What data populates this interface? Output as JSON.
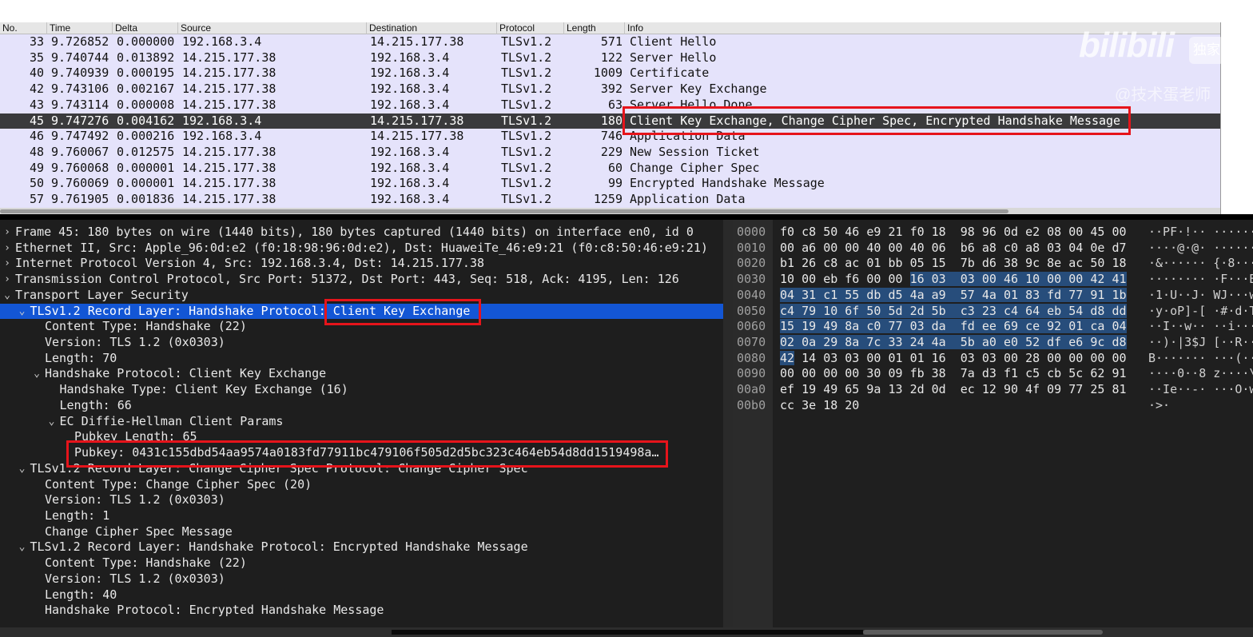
{
  "columns": [
    "No.",
    "Time",
    "Delta",
    "Source",
    "Destination",
    "Protocol",
    "Length",
    "Info"
  ],
  "packets": [
    {
      "no": "33",
      "time": "9.726852",
      "delta": "0.000000",
      "src": "192.168.3.4",
      "dst": "14.215.177.38",
      "proto": "TLSv1.2",
      "len": "571",
      "info": "Client Hello",
      "selected": false
    },
    {
      "no": "35",
      "time": "9.740744",
      "delta": "0.013892",
      "src": "14.215.177.38",
      "dst": "192.168.3.4",
      "proto": "TLSv1.2",
      "len": "122",
      "info": "Server Hello",
      "selected": false
    },
    {
      "no": "40",
      "time": "9.740939",
      "delta": "0.000195",
      "src": "14.215.177.38",
      "dst": "192.168.3.4",
      "proto": "TLSv1.2",
      "len": "1009",
      "info": "Certificate",
      "selected": false
    },
    {
      "no": "42",
      "time": "9.743106",
      "delta": "0.002167",
      "src": "14.215.177.38",
      "dst": "192.168.3.4",
      "proto": "TLSv1.2",
      "len": "392",
      "info": "Server Key Exchange",
      "selected": false
    },
    {
      "no": "43",
      "time": "9.743114",
      "delta": "0.000008",
      "src": "14.215.177.38",
      "dst": "192.168.3.4",
      "proto": "TLSv1.2",
      "len": "63",
      "info": "Server Hello Done",
      "selected": false
    },
    {
      "no": "45",
      "time": "9.747276",
      "delta": "0.004162",
      "src": "192.168.3.4",
      "dst": "14.215.177.38",
      "proto": "TLSv1.2",
      "len": "180",
      "info": "Client Key Exchange, Change Cipher Spec, Encrypted Handshake Message",
      "selected": true
    },
    {
      "no": "46",
      "time": "9.747492",
      "delta": "0.000216",
      "src": "192.168.3.4",
      "dst": "14.215.177.38",
      "proto": "TLSv1.2",
      "len": "746",
      "info": "Application Data",
      "selected": false
    },
    {
      "no": "48",
      "time": "9.760067",
      "delta": "0.012575",
      "src": "14.215.177.38",
      "dst": "192.168.3.4",
      "proto": "TLSv1.2",
      "len": "229",
      "info": "New Session Ticket",
      "selected": false
    },
    {
      "no": "49",
      "time": "9.760068",
      "delta": "0.000001",
      "src": "14.215.177.38",
      "dst": "192.168.3.4",
      "proto": "TLSv1.2",
      "len": "60",
      "info": "Change Cipher Spec",
      "selected": false
    },
    {
      "no": "50",
      "time": "9.760069",
      "delta": "0.000001",
      "src": "14.215.177.38",
      "dst": "192.168.3.4",
      "proto": "TLSv1.2",
      "len": "99",
      "info": "Encrypted Handshake Message",
      "selected": false
    },
    {
      "no": "57",
      "time": "9.761905",
      "delta": "0.001836",
      "src": "14.215.177.38",
      "dst": "192.168.3.4",
      "proto": "TLSv1.2",
      "len": "1259",
      "info": "Application Data",
      "selected": false
    }
  ],
  "details": [
    {
      "text": "Frame 45: 180 bytes on wire (1440 bits), 180 bytes captured (1440 bits) on interface en0, id 0",
      "level": 0,
      "arrow": "›"
    },
    {
      "text": "Ethernet II, Src: Apple_96:0d:e2 (f0:18:98:96:0d:e2), Dst: HuaweiTe_46:e9:21 (f0:c8:50:46:e9:21)",
      "level": 0,
      "arrow": "›"
    },
    {
      "text": "Internet Protocol Version 4, Src: 192.168.3.4, Dst: 14.215.177.38",
      "level": 0,
      "arrow": "›"
    },
    {
      "text": "Transmission Control Protocol, Src Port: 51372, Dst Port: 443, Seq: 518, Ack: 4195, Len: 126",
      "level": 0,
      "arrow": "›"
    },
    {
      "text": "Transport Layer Security",
      "level": 0,
      "arrow": "⌄"
    },
    {
      "text": "TLSv1.2 Record Layer: Handshake Protocol: Client Key Exchange",
      "level": 1,
      "arrow": "⌄",
      "selected": true
    },
    {
      "text": "Content Type: Handshake (22)",
      "level": 2,
      "arrow": ""
    },
    {
      "text": "Version: TLS 1.2 (0x0303)",
      "level": 2,
      "arrow": ""
    },
    {
      "text": "Length: 70",
      "level": 2,
      "arrow": ""
    },
    {
      "text": "Handshake Protocol: Client Key Exchange",
      "level": 2,
      "arrow": "⌄"
    },
    {
      "text": "Handshake Type: Client Key Exchange (16)",
      "level": 3,
      "arrow": ""
    },
    {
      "text": "Length: 66",
      "level": 3,
      "arrow": ""
    },
    {
      "text": "EC Diffie-Hellman Client Params",
      "level": 3,
      "arrow": "⌄"
    },
    {
      "text": "Pubkey Length: 65",
      "level": 4,
      "arrow": ""
    },
    {
      "text": "Pubkey: 0431c155dbd54aa9574a0183fd77911bc479106f505d2d5bc323c464eb54d8dd1519498a…",
      "level": 4,
      "arrow": ""
    },
    {
      "text": "TLSv1.2 Record Layer: Change Cipher Spec Protocol: Change Cipher Spec",
      "level": 1,
      "arrow": "⌄"
    },
    {
      "text": "Content Type: Change Cipher Spec (20)",
      "level": 2,
      "arrow": ""
    },
    {
      "text": "Version: TLS 1.2 (0x0303)",
      "level": 2,
      "arrow": ""
    },
    {
      "text": "Length: 1",
      "level": 2,
      "arrow": ""
    },
    {
      "text": "Change Cipher Spec Message",
      "level": 2,
      "arrow": ""
    },
    {
      "text": "TLSv1.2 Record Layer: Handshake Protocol: Encrypted Handshake Message",
      "level": 1,
      "arrow": "⌄"
    },
    {
      "text": "Content Type: Handshake (22)",
      "level": 2,
      "arrow": ""
    },
    {
      "text": "Version: TLS 1.2 (0x0303)",
      "level": 2,
      "arrow": ""
    },
    {
      "text": "Length: 40",
      "level": 2,
      "arrow": ""
    },
    {
      "text": "Handshake Protocol: Encrypted Handshake Message",
      "level": 2,
      "arrow": ""
    }
  ],
  "hexdump": [
    {
      "offset": "0000",
      "bytes": [
        "f0",
        "c8",
        "50",
        "46",
        "e9",
        "21",
        "f0",
        "18",
        "98",
        "96",
        "0d",
        "e2",
        "08",
        "00",
        "45",
        "00"
      ],
      "ascii": "··PF·!·· ······E·",
      "hl_start": -1
    },
    {
      "offset": "0010",
      "bytes": [
        "00",
        "a6",
        "00",
        "00",
        "40",
        "00",
        "40",
        "06",
        "b6",
        "a8",
        "c0",
        "a8",
        "03",
        "04",
        "0e",
        "d7"
      ],
      "ascii": "····@·@· ········",
      "hl_start": -1
    },
    {
      "offset": "0020",
      "bytes": [
        "b1",
        "26",
        "c8",
        "ac",
        "01",
        "bb",
        "05",
        "15",
        "7b",
        "d6",
        "38",
        "9c",
        "8e",
        "ac",
        "50",
        "18"
      ],
      "ascii": "·&······ {·8···P·",
      "hl_start": -1
    },
    {
      "offset": "0030",
      "bytes": [
        "10",
        "00",
        "eb",
        "f6",
        "00",
        "00",
        "16",
        "03",
        "03",
        "00",
        "46",
        "10",
        "00",
        "00",
        "42",
        "41"
      ],
      "ascii": "········ ·F···BA",
      "hl_start": 6
    },
    {
      "offset": "0040",
      "bytes": [
        "04",
        "31",
        "c1",
        "55",
        "db",
        "d5",
        "4a",
        "a9",
        "57",
        "4a",
        "01",
        "83",
        "fd",
        "77",
        "91",
        "1b"
      ],
      "ascii": "·1·U··J· WJ···w··",
      "hl_start": 0
    },
    {
      "offset": "0050",
      "bytes": [
        "c4",
        "79",
        "10",
        "6f",
        "50",
        "5d",
        "2d",
        "5b",
        "c3",
        "23",
        "c4",
        "64",
        "eb",
        "54",
        "d8",
        "dd"
      ],
      "ascii": "·y·oP]-[ ·#·d·T··",
      "hl_start": 0
    },
    {
      "offset": "0060",
      "bytes": [
        "15",
        "19",
        "49",
        "8a",
        "c0",
        "77",
        "03",
        "da",
        "fd",
        "ee",
        "69",
        "ce",
        "92",
        "01",
        "ca",
        "04"
      ],
      "ascii": "··I··w·· ··i·····",
      "hl_start": 0
    },
    {
      "offset": "0070",
      "bytes": [
        "02",
        "0a",
        "29",
        "8a",
        "7c",
        "33",
        "24",
        "4a",
        "5b",
        "a0",
        "e0",
        "52",
        "df",
        "e6",
        "9c",
        "d8"
      ],
      "ascii": "··)·|3$J [··R····",
      "hl_start": 0
    },
    {
      "offset": "0080",
      "bytes": [
        "42",
        "14",
        "03",
        "03",
        "00",
        "01",
        "01",
        "16",
        "03",
        "03",
        "00",
        "28",
        "00",
        "00",
        "00",
        "00"
      ],
      "ascii": "B······· ···(····",
      "hl_start": 0,
      "hl_end": 1
    },
    {
      "offset": "0090",
      "bytes": [
        "00",
        "00",
        "00",
        "00",
        "30",
        "09",
        "fb",
        "38",
        "7a",
        "d3",
        "f1",
        "c5",
        "cb",
        "5c",
        "62",
        "91"
      ],
      "ascii": "····0··8 z····\\b·",
      "hl_start": -1
    },
    {
      "offset": "00a0",
      "bytes": [
        "ef",
        "19",
        "49",
        "65",
        "9a",
        "13",
        "2d",
        "0d",
        "ec",
        "12",
        "90",
        "4f",
        "09",
        "77",
        "25",
        "81"
      ],
      "ascii": "··Ie··-· ···O·w%·",
      "hl_start": -1
    },
    {
      "offset": "00b0",
      "bytes": [
        "cc",
        "3e",
        "18",
        "20"
      ],
      "ascii": "·>· ",
      "hl_start": -1
    }
  ],
  "watermark": {
    "logo": "bilibili",
    "badge": "独家",
    "handle": "@技术蛋老师"
  },
  "colors": {
    "row_bg": "#e5e3fb",
    "selected_row": "#3a3a3c",
    "detail_selected": "#1356d5",
    "highlight_bytes": "#274d7b",
    "annotation": "#e6141b"
  }
}
